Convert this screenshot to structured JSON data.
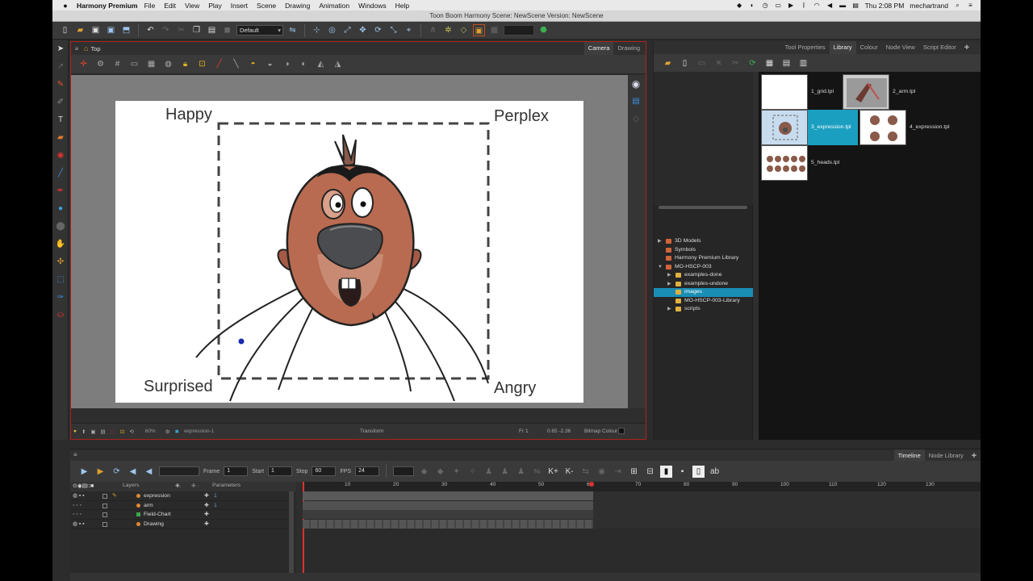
{
  "menubar": {
    "app_name": "Harmony Premium",
    "items": [
      "File",
      "Edit",
      "View",
      "Play",
      "Insert",
      "Scene",
      "Drawing",
      "Animation",
      "Windows",
      "Help"
    ],
    "clock": "Thu 2:08 PM",
    "user": "mechartrand"
  },
  "window": {
    "title": "Toon Boom Harmony Scene: NewScene Version: NewScene"
  },
  "toolbar": {
    "preset": "Default"
  },
  "camera": {
    "breadcrumb": "Top",
    "tabs": [
      "Camera",
      "Drawing"
    ],
    "labels": {
      "top_left": "Happy",
      "top_right": "Perplex",
      "bottom_left": "Surprised",
      "bottom_right": "Angry"
    },
    "status": {
      "zoom": "60%",
      "drawing": "expression-1",
      "tool": "Transform",
      "frame": "Fr 1",
      "coords": "0.65 -2.36",
      "mode": "Bitmap Colour"
    }
  },
  "library": {
    "tabs": [
      "Tool Properties",
      "Library",
      "Colour",
      "Node View",
      "Script Editor"
    ],
    "active_tab": "Library",
    "tree": [
      {
        "label": "3D Models",
        "level": 0,
        "color": "#d2643a"
      },
      {
        "label": "Symbols",
        "level": 0,
        "color": "#d2643a"
      },
      {
        "label": "Harmony Premium Library",
        "level": 0,
        "color": "#d2643a"
      },
      {
        "label": "MO-HSCP-003",
        "level": 0,
        "color": "#d2643a"
      },
      {
        "label": "examples-done",
        "level": 1,
        "color": "#e0b040"
      },
      {
        "label": "examples-undone",
        "level": 1,
        "color": "#e0b040"
      },
      {
        "label": "images",
        "level": 1,
        "color": "#e0b040",
        "selected": true
      },
      {
        "label": "MO-HSCP-003-Library",
        "level": 1,
        "color": "#e0b040"
      },
      {
        "label": "scripts",
        "level": 1,
        "color": "#e0b040"
      }
    ],
    "templates": [
      "1_grid.tpl",
      "2_arm.tpl",
      "3_expression.tpl",
      "4_expression.tpl",
      "5_heads.tpl"
    ],
    "selected_template": "3_expression.tpl"
  },
  "timeline": {
    "tabs": [
      "Timeline",
      "Node Library"
    ],
    "active_tab": "Timeline",
    "frame_label": "Frame",
    "frame": "1",
    "start_label": "Start",
    "start": "1",
    "stop_label": "Stop",
    "stop": "60",
    "fps_label": "FPS",
    "fps": "24",
    "layers_header": "Layers",
    "params_header": "Parameters",
    "layers": [
      {
        "name": "expression",
        "color": "#e08a30",
        "param": "1"
      },
      {
        "name": "arm",
        "color": "#e08a30",
        "param": "1"
      },
      {
        "name": "Field-Chart",
        "color": "#3aa84a",
        "param": ""
      },
      {
        "name": "Drawing",
        "color": "#e08a30",
        "param": ""
      }
    ],
    "ruler": [
      "10",
      "20",
      "30",
      "40",
      "50",
      "60",
      "70",
      "80",
      "90",
      "100",
      "110",
      "120",
      "130"
    ]
  }
}
